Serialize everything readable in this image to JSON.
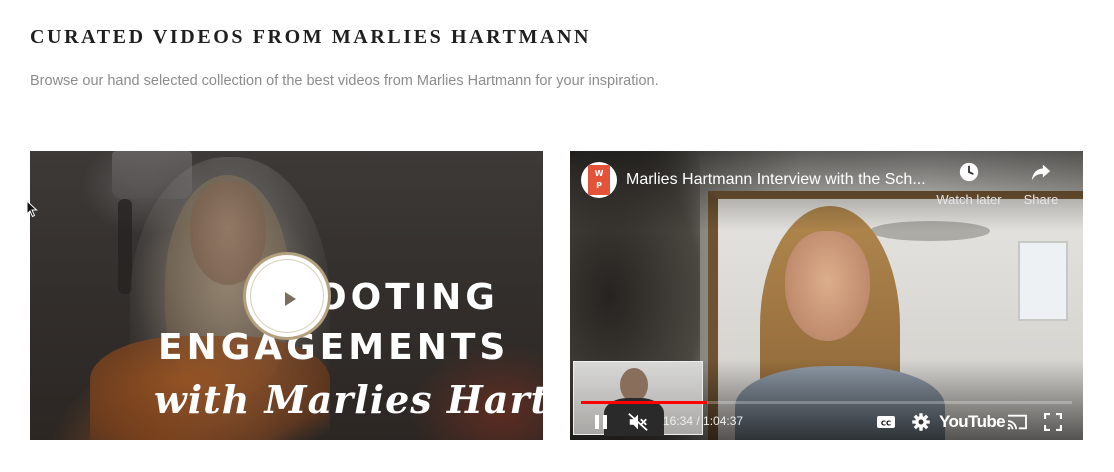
{
  "section": {
    "heading": "CURATED VIDEOS FROM MARLIES HARTMANN",
    "description": "Browse our hand selected collection of the best videos from Marlies Hartmann for your inspiration."
  },
  "video_left": {
    "overlay_line1": "OOTING",
    "overlay_line2": "ENGAGEMENTS",
    "overlay_line3": "with Marlies Hartmann",
    "play_icon": "play-icon"
  },
  "video_right": {
    "channel_avatar_text": "W\nP",
    "title": "Marlies Hartmann Interview with the Sch...",
    "watch_later_label": "Watch later",
    "share_label": "Share",
    "time": "16:34 / 1:04:37",
    "progress": 0.2565,
    "logo": "YouTube",
    "icons": [
      "clock-icon",
      "share-arrow-icon",
      "pause-icon",
      "mute-icon",
      "captions-icon",
      "gear-icon",
      "cast-icon",
      "fullscreen-icon"
    ]
  },
  "colors": {
    "heading": "#1f1f1f",
    "description": "#8c8c8c",
    "progress_red": "#ff0000",
    "channel_avatar": "#e2533a"
  }
}
